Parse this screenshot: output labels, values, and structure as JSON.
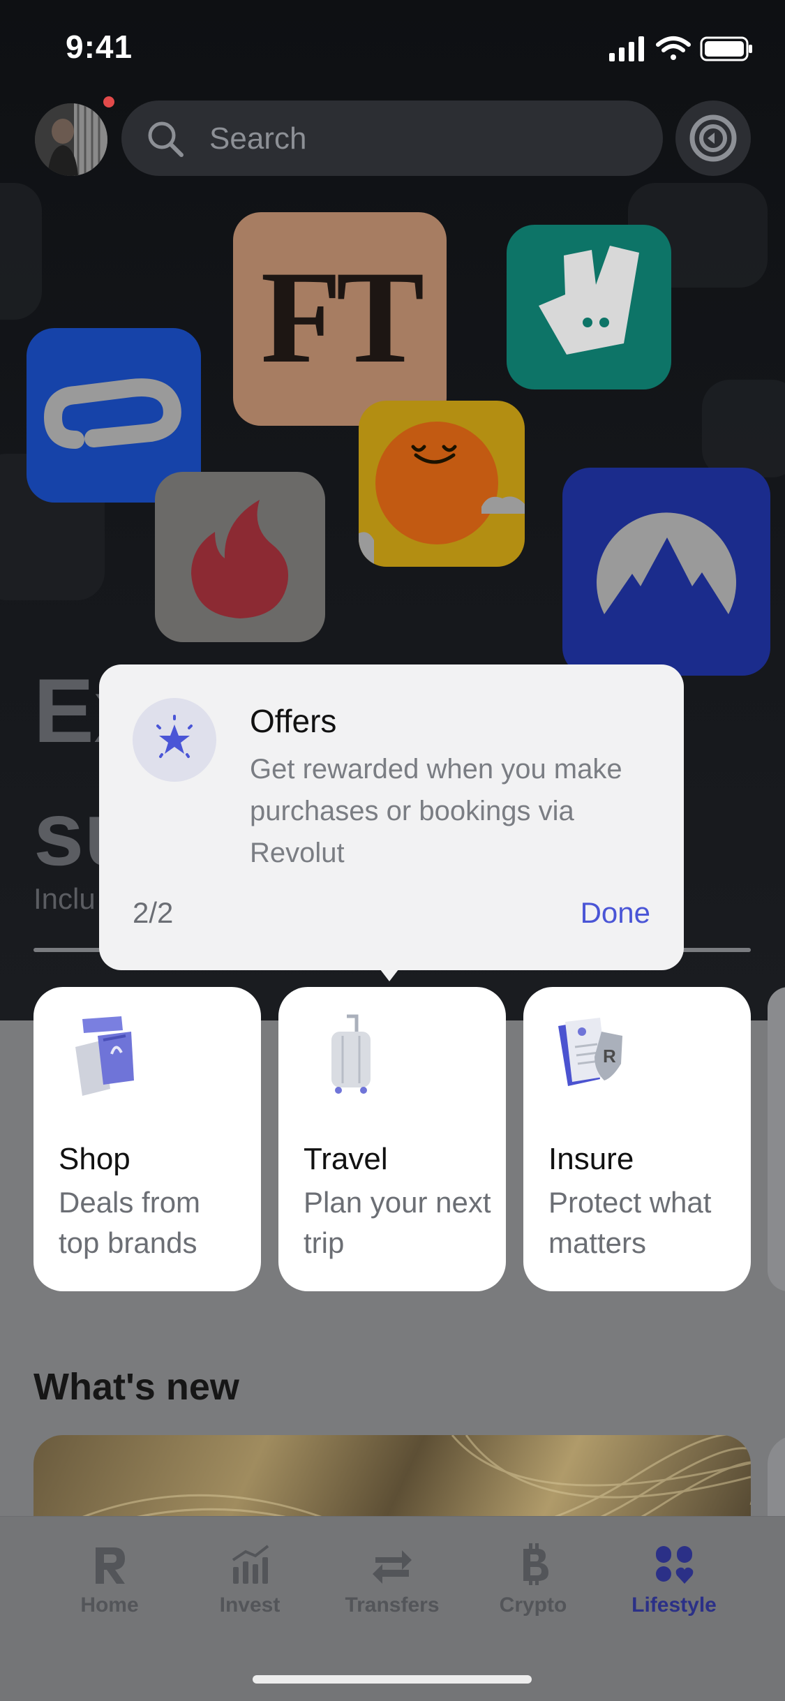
{
  "status_bar": {
    "time": "9:41"
  },
  "search": {
    "placeholder": "Search"
  },
  "hero": {
    "title_line1": "Ex",
    "title_line2": "su",
    "subtitle": "Inclu",
    "progress_fraction": 1.0
  },
  "app_tiles": [
    {
      "name": "FT",
      "label": "FT"
    },
    {
      "name": "Deliveroo"
    },
    {
      "name": "Clearpay"
    },
    {
      "name": "Headspace"
    },
    {
      "name": "Tinder"
    },
    {
      "name": "NordVPN"
    }
  ],
  "tooltip": {
    "title": "Offers",
    "description": "Get rewarded when you make purchases or bookings via Revolut",
    "step": "2/2",
    "done_label": "Done",
    "accent": "#4a55d6"
  },
  "cards": [
    {
      "title": "Shop",
      "description": "Deals from top brands",
      "icon": "shopping-bag-icon"
    },
    {
      "title": "Travel",
      "description": "Plan your next trip",
      "icon": "suitcase-icon"
    },
    {
      "title": "Insure",
      "description": "Protect what matters",
      "icon": "insurance-shield-icon"
    }
  ],
  "whats_new": {
    "title": "What's new"
  },
  "tabbar": {
    "items": [
      {
        "label": "Home",
        "icon": "revolut-r-icon",
        "active": false
      },
      {
        "label": "Invest",
        "icon": "chart-bars-icon",
        "active": false
      },
      {
        "label": "Transfers",
        "icon": "arrows-swap-icon",
        "active": false
      },
      {
        "label": "Crypto",
        "icon": "bitcoin-icon",
        "active": false
      },
      {
        "label": "Lifestyle",
        "icon": "lifestyle-icon",
        "active": true
      }
    ],
    "active_color": "#2b3087"
  }
}
